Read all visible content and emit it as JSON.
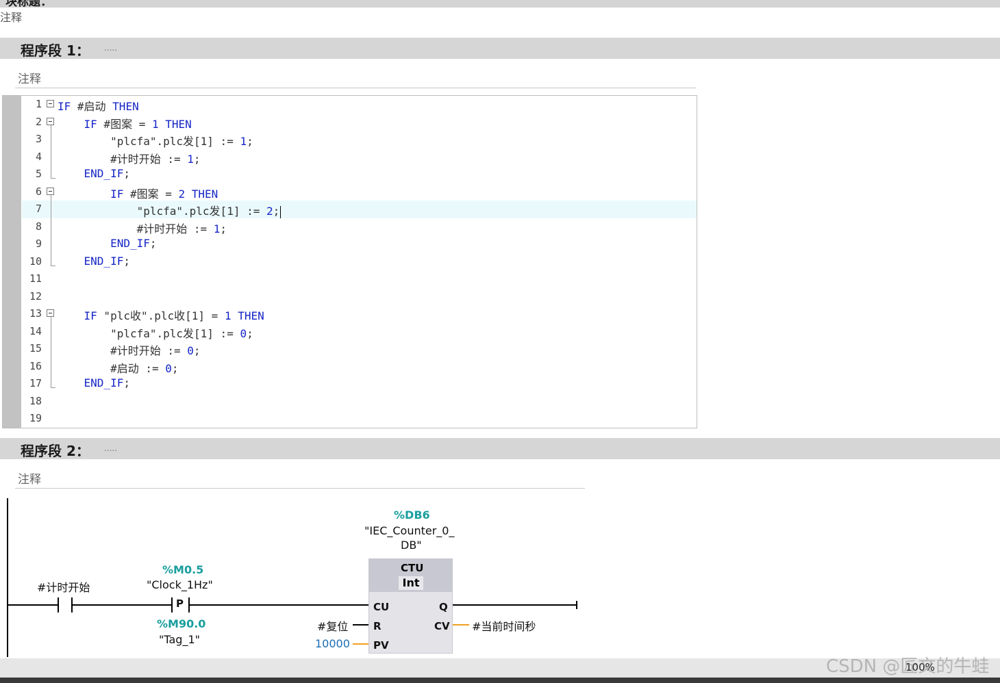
{
  "top": {
    "title_partial": "块标题：",
    "comment": "注释"
  },
  "networks": [
    {
      "title": "程序段 1：",
      "dots": ".....",
      "comment_placeholder": "注释"
    },
    {
      "title": "程序段 2：",
      "dots": ".....",
      "comment_placeholder": "注释"
    }
  ],
  "scl": {
    "lines": [
      {
        "n": "1",
        "code": "IF #启动 THEN"
      },
      {
        "n": "2",
        "code": "    IF #图案 = 1 THEN"
      },
      {
        "n": "3",
        "code": "        \"plcfa\".plc发[1] := 1;"
      },
      {
        "n": "4",
        "code": "        #计时开始 := 1;"
      },
      {
        "n": "5",
        "code": "    END_IF;"
      },
      {
        "n": "6",
        "code": "        IF #图案 = 2 THEN"
      },
      {
        "n": "7",
        "code": "            \"plcfa\".plc发[1] := 2;"
      },
      {
        "n": "8",
        "code": "            #计时开始 := 1;"
      },
      {
        "n": "9",
        "code": "        END_IF;"
      },
      {
        "n": "10",
        "code": "    END_IF;"
      },
      {
        "n": "11",
        "code": ""
      },
      {
        "n": "12",
        "code": ""
      },
      {
        "n": "13",
        "code": "    IF \"plc收\".plc收[1] = 1 THEN"
      },
      {
        "n": "14",
        "code": "        \"plcfa\".plc发[1] := 0;"
      },
      {
        "n": "15",
        "code": "        #计时开始 := 0;"
      },
      {
        "n": "16",
        "code": "        #启动 := 0;"
      },
      {
        "n": "17",
        "code": "    END_IF;"
      },
      {
        "n": "18",
        "code": ""
      },
      {
        "n": "19",
        "code": ""
      }
    ]
  },
  "ladder": {
    "contact1": {
      "name": "#计时开始"
    },
    "contact2": {
      "address": "%M0.5",
      "name": "\"Clock_1Hz\"",
      "type": "P",
      "mem_address": "%M90.0",
      "mem_name": "\"Tag_1\""
    },
    "counter": {
      "instance_address": "%DB6",
      "instance_name_1": "\"IEC_Counter_0_",
      "instance_name_2": "DB\"",
      "type": "CTU",
      "datatype": "Int",
      "pins": {
        "cu": "CU",
        "r": "R",
        "pv": "PV",
        "q": "Q",
        "cv": "CV"
      },
      "r_operand": "#复位",
      "pv_operand": "10000",
      "cv_operand": "#当前时间秒"
    }
  },
  "status": {
    "zoom": "100%",
    "watermark": "CSDN @匠文的牛蛙"
  },
  "colors": {
    "keyword": "#1525c6",
    "tag": "#1a9e9e",
    "wire_orange": "#f0a020",
    "header_bg": "#d6d6d6"
  }
}
